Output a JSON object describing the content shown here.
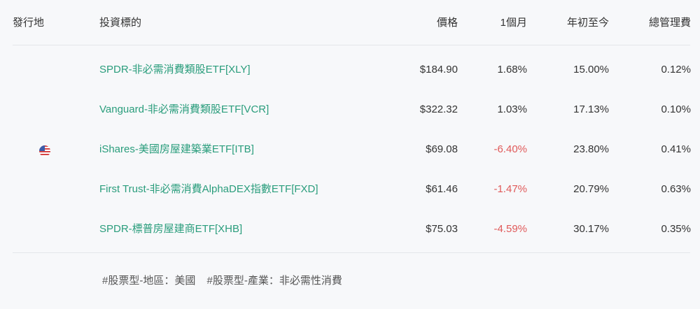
{
  "header": {
    "issuer": "發行地",
    "target": "投資標的",
    "price": "價格",
    "month": "1個月",
    "ytd": "年初至今",
    "fee": "總管理費"
  },
  "issuer_flag_icon": "us-flag-icon",
  "rows": [
    {
      "name": "SPDR-非必需消費類股ETF[XLY]",
      "price": "$184.90",
      "month": "1.68%",
      "ytd": "15.00%",
      "fee": "0.12%"
    },
    {
      "name": "Vanguard-非必需消費類股ETF[VCR]",
      "price": "$322.32",
      "month": "1.03%",
      "ytd": "17.13%",
      "fee": "0.10%"
    },
    {
      "name": "iShares-美國房屋建築業ETF[ITB]",
      "price": "$69.08",
      "month": "-6.40%",
      "ytd": "23.80%",
      "fee": "0.41%"
    },
    {
      "name": "First Trust-非必需消費AlphaDEX指數ETF[FXD]",
      "price": "$61.46",
      "month": "-1.47%",
      "ytd": "20.79%",
      "fee": "0.63%"
    },
    {
      "name": "SPDR-標普房屋建商ETF[XHB]",
      "price": "$75.03",
      "month": "-4.59%",
      "ytd": "30.17%",
      "fee": "0.35%"
    }
  ],
  "tags": [
    "#股票型-地區：美國",
    "#股票型-產業：非必需性消費"
  ],
  "colors": {
    "link": "#2a9d7c",
    "negative": "#e05a5a",
    "background": "#f7f8fa"
  }
}
